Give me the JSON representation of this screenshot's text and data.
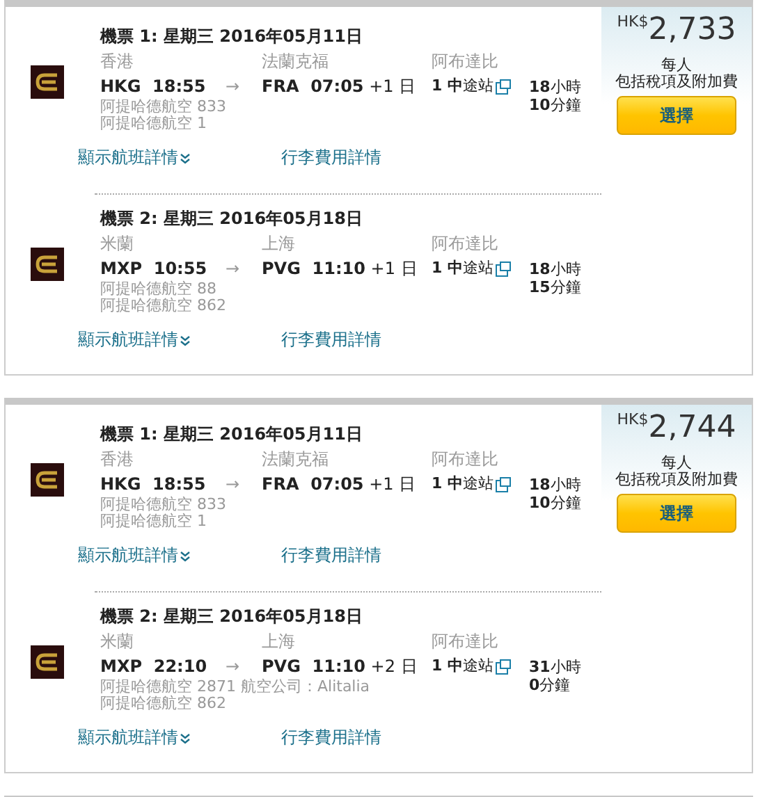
{
  "results": [
    {
      "price": {
        "currency": "HK$",
        "amount": "2,733",
        "per_person": "每人",
        "includes": "包括稅項及附加費"
      },
      "select_label": "選擇",
      "legs": [
        {
          "title": "機票 1: 星期三 2016年05月11日",
          "origin_city": "香港",
          "dest_city": "法蘭克福",
          "stop_city": "阿布達比",
          "origin_code": "HKG",
          "depart_time": "18:55",
          "arrow": "→",
          "dest_code": "FRA",
          "arrive_time": "07:05",
          "day_offset": "+1 日",
          "flights": [
            "阿提哈德航空 833",
            "阿提哈德航空 1"
          ],
          "stops": "**1 中**途站",
          "duration": "**18**小時 **10**分鐘",
          "details_link": "顯示航班詳情",
          "baggage_link": "行李費用詳情"
        },
        {
          "title": "機票 2: 星期三 2016年05月18日",
          "origin_city": "米蘭",
          "dest_city": "上海",
          "stop_city": "阿布達比",
          "origin_code": "MXP",
          "depart_time": "10:55",
          "arrow": "→",
          "dest_code": "PVG",
          "arrive_time": "11:10",
          "day_offset": "+1 日",
          "flights": [
            "阿提哈德航空 88",
            "阿提哈德航空 862"
          ],
          "stops": "**1 中**途站",
          "duration": "**18**小時 **15**分鐘",
          "details_link": "顯示航班詳情",
          "baggage_link": "行李費用詳情"
        }
      ]
    },
    {
      "price": {
        "currency": "HK$",
        "amount": "2,744",
        "per_person": "每人",
        "includes": "包括稅項及附加費"
      },
      "select_label": "選擇",
      "legs": [
        {
          "title": "機票 1: 星期三 2016年05月11日",
          "origin_city": "香港",
          "dest_city": "法蘭克福",
          "stop_city": "阿布達比",
          "origin_code": "HKG",
          "depart_time": "18:55",
          "arrow": "→",
          "dest_code": "FRA",
          "arrive_time": "07:05",
          "day_offset": "+1 日",
          "flights": [
            "阿提哈德航空 833",
            "阿提哈德航空 1"
          ],
          "stops": "**1 中**途站",
          "duration": "**18**小時 **10**分鐘",
          "details_link": "顯示航班詳情",
          "baggage_link": "行李費用詳情"
        },
        {
          "title": "機票 2: 星期三 2016年05月18日",
          "origin_city": "米蘭",
          "dest_city": "上海",
          "stop_city": "阿布達比",
          "origin_code": "MXP",
          "depart_time": "22:10",
          "arrow": "→",
          "dest_code": "PVG",
          "arrive_time": "11:10",
          "day_offset": "+2 日",
          "flights": [
            "阿提哈德航空 2871 航空公司：Alitalia",
            "阿提哈德航空 862"
          ],
          "stops": "**1 中**途站",
          "duration": "**31**小時 **0**分鐘",
          "details_link": "顯示航班詳情",
          "baggage_link": "行李費用詳情"
        }
      ]
    }
  ]
}
